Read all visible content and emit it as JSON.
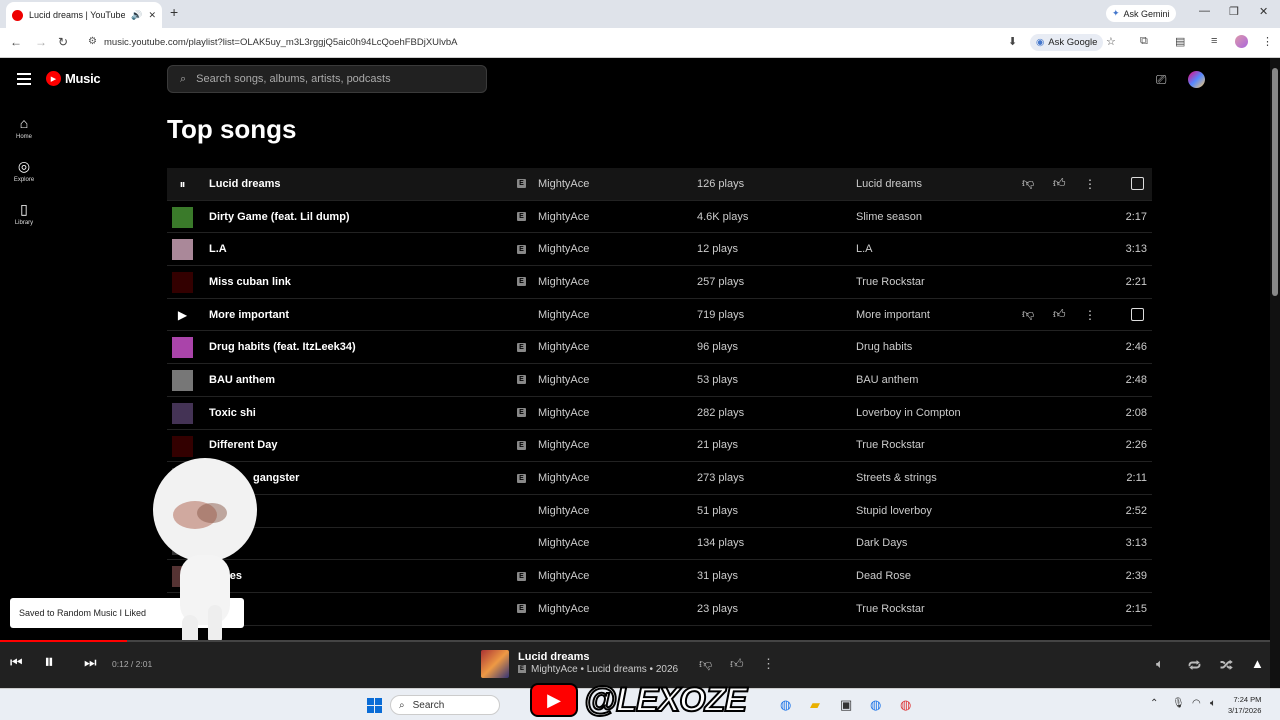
{
  "browser": {
    "tab_title": "Lucid dreams | YouTube Mu...",
    "ask_gemini": "Ask Gemini",
    "url": "music.youtube.com/playlist?list=OLAK5uy_m3L3rggjQ5aic0h94LcQoehFBDjXUlvbA",
    "ask_google": "Ask Google"
  },
  "header": {
    "logo_text": "Music",
    "search_placeholder": "Search songs, albums, artists, podcasts"
  },
  "sidebar": {
    "items": [
      {
        "label": "Home",
        "icon": "home-icon"
      },
      {
        "label": "Explore",
        "icon": "explore-icon"
      },
      {
        "label": "Library",
        "icon": "library-icon"
      }
    ]
  },
  "main": {
    "title": "Top songs",
    "songs": [
      {
        "title": "Lucid dreams",
        "explicit": true,
        "artist": "MightyAce",
        "plays": "126 plays",
        "album": "Lucid dreams",
        "duration": "",
        "state": "playing"
      },
      {
        "title": "Dirty Game (feat. Lil dump)",
        "explicit": true,
        "artist": "MightyAce",
        "plays": "4.6K plays",
        "album": "Slime season",
        "duration": "2:17"
      },
      {
        "title": "L.A",
        "explicit": true,
        "artist": "MightyAce",
        "plays": "12 plays",
        "album": "L.A",
        "duration": "3:13"
      },
      {
        "title": "Miss cuban link",
        "explicit": true,
        "artist": "MightyAce",
        "plays": "257 plays",
        "album": "True Rockstar",
        "duration": "2:21"
      },
      {
        "title": "More important",
        "explicit": false,
        "artist": "MightyAce",
        "plays": "719 plays",
        "album": "More important",
        "duration": "",
        "state": "hover"
      },
      {
        "title": "Drug habits (feat. ItzLeek34)",
        "explicit": true,
        "artist": "MightyAce",
        "plays": "96 plays",
        "album": "Drug habits",
        "duration": "2:46"
      },
      {
        "title": "BAU anthem",
        "explicit": true,
        "artist": "MightyAce",
        "plays": "53 plays",
        "album": "BAU anthem",
        "duration": "2:48"
      },
      {
        "title": "Toxic shi",
        "explicit": true,
        "artist": "MightyAce",
        "plays": "282 plays",
        "album": "Loverboy in Compton",
        "duration": "2:08"
      },
      {
        "title": "Different Day",
        "explicit": true,
        "artist": "MightyAce",
        "plays": "21 plays",
        "album": "True Rockstar",
        "duration": "2:26"
      },
      {
        "title": "gangster",
        "explicit": true,
        "artist": "MightyAce",
        "plays": "273 plays",
        "album": "Streets & strings",
        "duration": "2:11"
      },
      {
        "title": "",
        "explicit": false,
        "artist": "MightyAce",
        "plays": "51 plays",
        "album": "Stupid loverboy",
        "duration": "2:52"
      },
      {
        "title": "",
        "explicit": false,
        "artist": "MightyAce",
        "plays": "134 plays",
        "album": "Dark Days",
        "duration": "3:13"
      },
      {
        "title": "Roses",
        "explicit": true,
        "artist": "MightyAce",
        "plays": "31 plays",
        "album": "Dead Rose",
        "duration": "2:39"
      },
      {
        "title": "",
        "explicit": true,
        "artist": "MightyAce",
        "plays": "23 plays",
        "album": "True Rockstar",
        "duration": "2:15"
      }
    ]
  },
  "toast": {
    "text": "Saved to Random Music I Liked"
  },
  "player": {
    "time": "0:12 / 2:01",
    "progress": 0.1,
    "title": "Lucid dreams",
    "subtitle": "MightyAce • Lucid dreams • 2026"
  },
  "taskbar": {
    "search": "Search",
    "time": "7:24 PM",
    "date": "3/17/2026"
  },
  "overlay": {
    "handle": "@LEXOZE"
  },
  "colors": {
    "accent": "#ff0000",
    "background": "#000000",
    "row_active": "#151515"
  }
}
